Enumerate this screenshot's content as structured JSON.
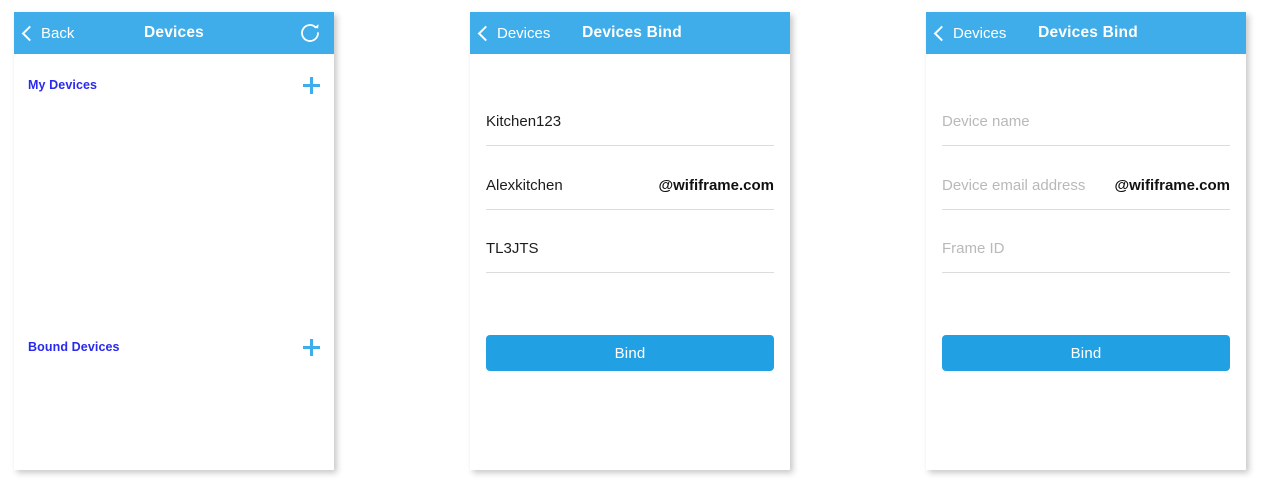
{
  "colors": {
    "navbar_blue": "#3fade9",
    "button_blue": "#22a0e4",
    "link_blue": "#2a2aee",
    "plus_blue": "#3dadec",
    "placeholder_gray": "#b9b9b9",
    "divider_gray": "#dcdcdc"
  },
  "screens": {
    "devices": {
      "nav": {
        "back_label": "Back",
        "title": "Devices",
        "back_icon": "chevron-left-icon",
        "refresh_icon": "refresh-icon"
      },
      "sections": [
        {
          "label": "My Devices",
          "add_icon": "plus-icon"
        },
        {
          "label": "Bound Devices",
          "add_icon": "plus-icon"
        }
      ]
    },
    "devices_bind_filled": {
      "nav": {
        "back_label": "Devices",
        "title": "Devices Bind",
        "back_icon": "chevron-left-icon"
      },
      "fields": [
        {
          "value": "Kitchen123",
          "placeholder": "Device name",
          "suffix": ""
        },
        {
          "value": "Alexkitchen",
          "placeholder": "Device email address",
          "suffix": "@wififrame.com"
        },
        {
          "value": "TL3JTS",
          "placeholder": "Frame ID",
          "suffix": ""
        }
      ],
      "submit_label": "Bind"
    },
    "devices_bind_empty": {
      "nav": {
        "back_label": "Devices",
        "title": "Devices Bind",
        "back_icon": "chevron-left-icon"
      },
      "fields": [
        {
          "value": "",
          "placeholder": "Device name",
          "suffix": ""
        },
        {
          "value": "",
          "placeholder": "Device email address",
          "suffix": "@wififrame.com"
        },
        {
          "value": "",
          "placeholder": "Frame ID",
          "suffix": ""
        }
      ],
      "submit_label": "Bind"
    }
  }
}
